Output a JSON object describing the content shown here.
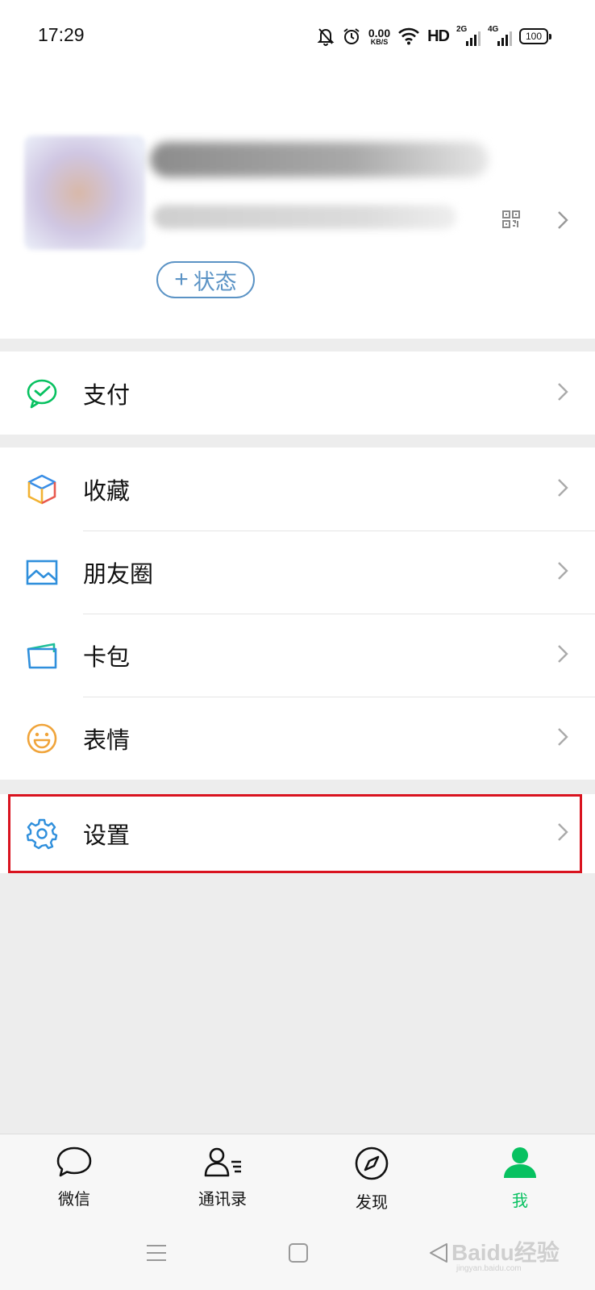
{
  "status_bar": {
    "time": "17:29",
    "net_speed_value": "0.00",
    "net_speed_unit": "KB/S",
    "hd_label": "HD",
    "sim1_type": "2G",
    "sim2_type": "4G",
    "battery": "100",
    "icons": [
      "mute-bell-icon",
      "alarm-icon",
      "wifi-icon",
      "signal-icon",
      "battery-icon"
    ]
  },
  "profile": {
    "nickname": "",
    "wechat_id": "",
    "status_button": {
      "plus": "+",
      "label": "状态"
    },
    "icons": [
      "qr-code-icon",
      "chevron-right-icon"
    ]
  },
  "menu": {
    "pay": {
      "label": "支付",
      "icon": "wechat-pay-icon"
    },
    "favorites": {
      "label": "收藏",
      "icon": "favorites-cube-icon"
    },
    "moments": {
      "label": "朋友圈",
      "icon": "moments-picture-icon"
    },
    "cards": {
      "label": "卡包",
      "icon": "card-wallet-icon"
    },
    "stickers": {
      "label": "表情",
      "icon": "smiley-icon"
    },
    "settings": {
      "label": "设置",
      "icon": "gear-icon"
    }
  },
  "tabs": [
    {
      "label": "微信",
      "icon": "chat-bubble-icon",
      "active": false
    },
    {
      "label": "通讯录",
      "icon": "contacts-icon",
      "active": false
    },
    {
      "label": "发现",
      "icon": "compass-icon",
      "active": false
    },
    {
      "label": "我",
      "icon": "person-icon",
      "active": true
    }
  ],
  "nav_bar": {
    "icons": [
      "menu-lines-icon",
      "home-square-icon",
      "back-triangle-icon"
    ]
  },
  "watermark": {
    "text": "Baidu经验",
    "sub": "jingyan.baidu.com"
  },
  "colors": {
    "accent_green": "#07c160",
    "status_blue": "#5b93c5",
    "highlight_red": "#d9131f",
    "background": "#ededed"
  }
}
